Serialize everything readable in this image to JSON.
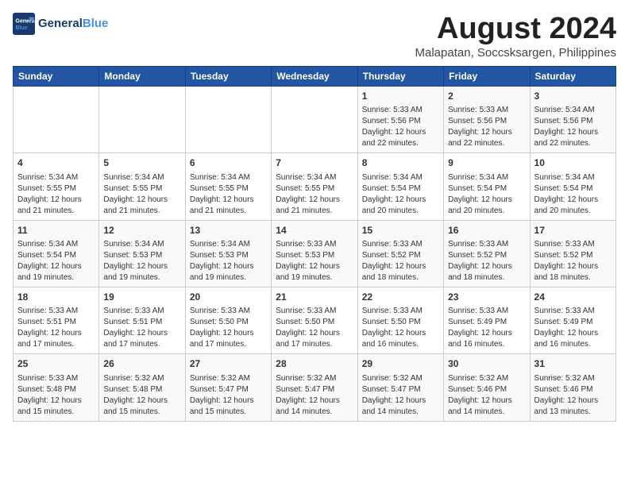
{
  "logo": {
    "text1": "General",
    "text2": "Blue"
  },
  "title": "August 2024",
  "location": "Malapatan, Soccsksargen, Philippines",
  "days_of_week": [
    "Sunday",
    "Monday",
    "Tuesday",
    "Wednesday",
    "Thursday",
    "Friday",
    "Saturday"
  ],
  "weeks": [
    [
      {
        "day": "",
        "info": ""
      },
      {
        "day": "",
        "info": ""
      },
      {
        "day": "",
        "info": ""
      },
      {
        "day": "",
        "info": ""
      },
      {
        "day": "1",
        "info": "Sunrise: 5:33 AM\nSunset: 5:56 PM\nDaylight: 12 hours\nand 22 minutes."
      },
      {
        "day": "2",
        "info": "Sunrise: 5:33 AM\nSunset: 5:56 PM\nDaylight: 12 hours\nand 22 minutes."
      },
      {
        "day": "3",
        "info": "Sunrise: 5:34 AM\nSunset: 5:56 PM\nDaylight: 12 hours\nand 22 minutes."
      }
    ],
    [
      {
        "day": "4",
        "info": "Sunrise: 5:34 AM\nSunset: 5:55 PM\nDaylight: 12 hours\nand 21 minutes."
      },
      {
        "day": "5",
        "info": "Sunrise: 5:34 AM\nSunset: 5:55 PM\nDaylight: 12 hours\nand 21 minutes."
      },
      {
        "day": "6",
        "info": "Sunrise: 5:34 AM\nSunset: 5:55 PM\nDaylight: 12 hours\nand 21 minutes."
      },
      {
        "day": "7",
        "info": "Sunrise: 5:34 AM\nSunset: 5:55 PM\nDaylight: 12 hours\nand 21 minutes."
      },
      {
        "day": "8",
        "info": "Sunrise: 5:34 AM\nSunset: 5:54 PM\nDaylight: 12 hours\nand 20 minutes."
      },
      {
        "day": "9",
        "info": "Sunrise: 5:34 AM\nSunset: 5:54 PM\nDaylight: 12 hours\nand 20 minutes."
      },
      {
        "day": "10",
        "info": "Sunrise: 5:34 AM\nSunset: 5:54 PM\nDaylight: 12 hours\nand 20 minutes."
      }
    ],
    [
      {
        "day": "11",
        "info": "Sunrise: 5:34 AM\nSunset: 5:54 PM\nDaylight: 12 hours\nand 19 minutes."
      },
      {
        "day": "12",
        "info": "Sunrise: 5:34 AM\nSunset: 5:53 PM\nDaylight: 12 hours\nand 19 minutes."
      },
      {
        "day": "13",
        "info": "Sunrise: 5:34 AM\nSunset: 5:53 PM\nDaylight: 12 hours\nand 19 minutes."
      },
      {
        "day": "14",
        "info": "Sunrise: 5:33 AM\nSunset: 5:53 PM\nDaylight: 12 hours\nand 19 minutes."
      },
      {
        "day": "15",
        "info": "Sunrise: 5:33 AM\nSunset: 5:52 PM\nDaylight: 12 hours\nand 18 minutes."
      },
      {
        "day": "16",
        "info": "Sunrise: 5:33 AM\nSunset: 5:52 PM\nDaylight: 12 hours\nand 18 minutes."
      },
      {
        "day": "17",
        "info": "Sunrise: 5:33 AM\nSunset: 5:52 PM\nDaylight: 12 hours\nand 18 minutes."
      }
    ],
    [
      {
        "day": "18",
        "info": "Sunrise: 5:33 AM\nSunset: 5:51 PM\nDaylight: 12 hours\nand 17 minutes."
      },
      {
        "day": "19",
        "info": "Sunrise: 5:33 AM\nSunset: 5:51 PM\nDaylight: 12 hours\nand 17 minutes."
      },
      {
        "day": "20",
        "info": "Sunrise: 5:33 AM\nSunset: 5:50 PM\nDaylight: 12 hours\nand 17 minutes."
      },
      {
        "day": "21",
        "info": "Sunrise: 5:33 AM\nSunset: 5:50 PM\nDaylight: 12 hours\nand 17 minutes."
      },
      {
        "day": "22",
        "info": "Sunrise: 5:33 AM\nSunset: 5:50 PM\nDaylight: 12 hours\nand 16 minutes."
      },
      {
        "day": "23",
        "info": "Sunrise: 5:33 AM\nSunset: 5:49 PM\nDaylight: 12 hours\nand 16 minutes."
      },
      {
        "day": "24",
        "info": "Sunrise: 5:33 AM\nSunset: 5:49 PM\nDaylight: 12 hours\nand 16 minutes."
      }
    ],
    [
      {
        "day": "25",
        "info": "Sunrise: 5:33 AM\nSunset: 5:48 PM\nDaylight: 12 hours\nand 15 minutes."
      },
      {
        "day": "26",
        "info": "Sunrise: 5:32 AM\nSunset: 5:48 PM\nDaylight: 12 hours\nand 15 minutes."
      },
      {
        "day": "27",
        "info": "Sunrise: 5:32 AM\nSunset: 5:47 PM\nDaylight: 12 hours\nand 15 minutes."
      },
      {
        "day": "28",
        "info": "Sunrise: 5:32 AM\nSunset: 5:47 PM\nDaylight: 12 hours\nand 14 minutes."
      },
      {
        "day": "29",
        "info": "Sunrise: 5:32 AM\nSunset: 5:47 PM\nDaylight: 12 hours\nand 14 minutes."
      },
      {
        "day": "30",
        "info": "Sunrise: 5:32 AM\nSunset: 5:46 PM\nDaylight: 12 hours\nand 14 minutes."
      },
      {
        "day": "31",
        "info": "Sunrise: 5:32 AM\nSunset: 5:46 PM\nDaylight: 12 hours\nand 13 minutes."
      }
    ]
  ]
}
